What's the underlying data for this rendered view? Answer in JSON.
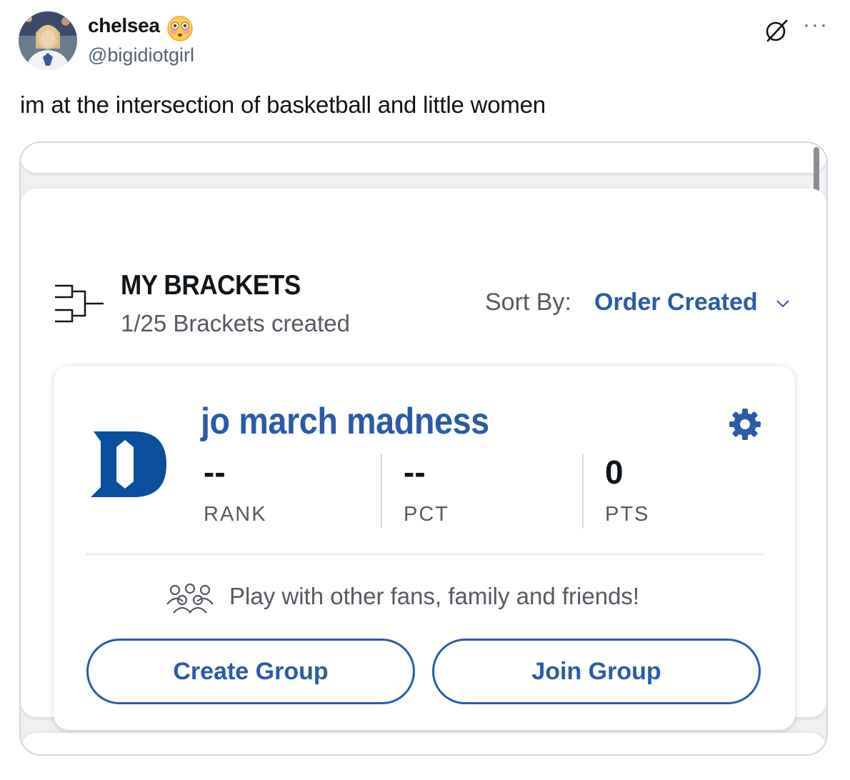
{
  "tweet": {
    "display_name": "chelsea",
    "display_name_emoji": "flushed-face-emoji",
    "handle": "@bigidiotgirl",
    "text": "im at the intersection of basketball and little women",
    "more_glyph": "···"
  },
  "app": {
    "section_title": "MY BRACKETS",
    "brackets_count": "1/25 Brackets created",
    "sort_label": "Sort By:",
    "sort_value": "Order Created",
    "bracket": {
      "name": "jo march madness",
      "team_logo": "duke-d-logo",
      "stats": [
        {
          "value": "--",
          "label": "RANK"
        },
        {
          "value": "--",
          "label": "PCT"
        },
        {
          "value": "0",
          "label": "PTS"
        }
      ]
    },
    "promo_text": "Play with other fans, family and friends!",
    "create_group_label": "Create Group",
    "join_group_label": "Join Group"
  },
  "colors": {
    "brand_blue": "#2b5ba8",
    "duke_blue": "#0b4f9c",
    "text_gray": "#545a61"
  }
}
